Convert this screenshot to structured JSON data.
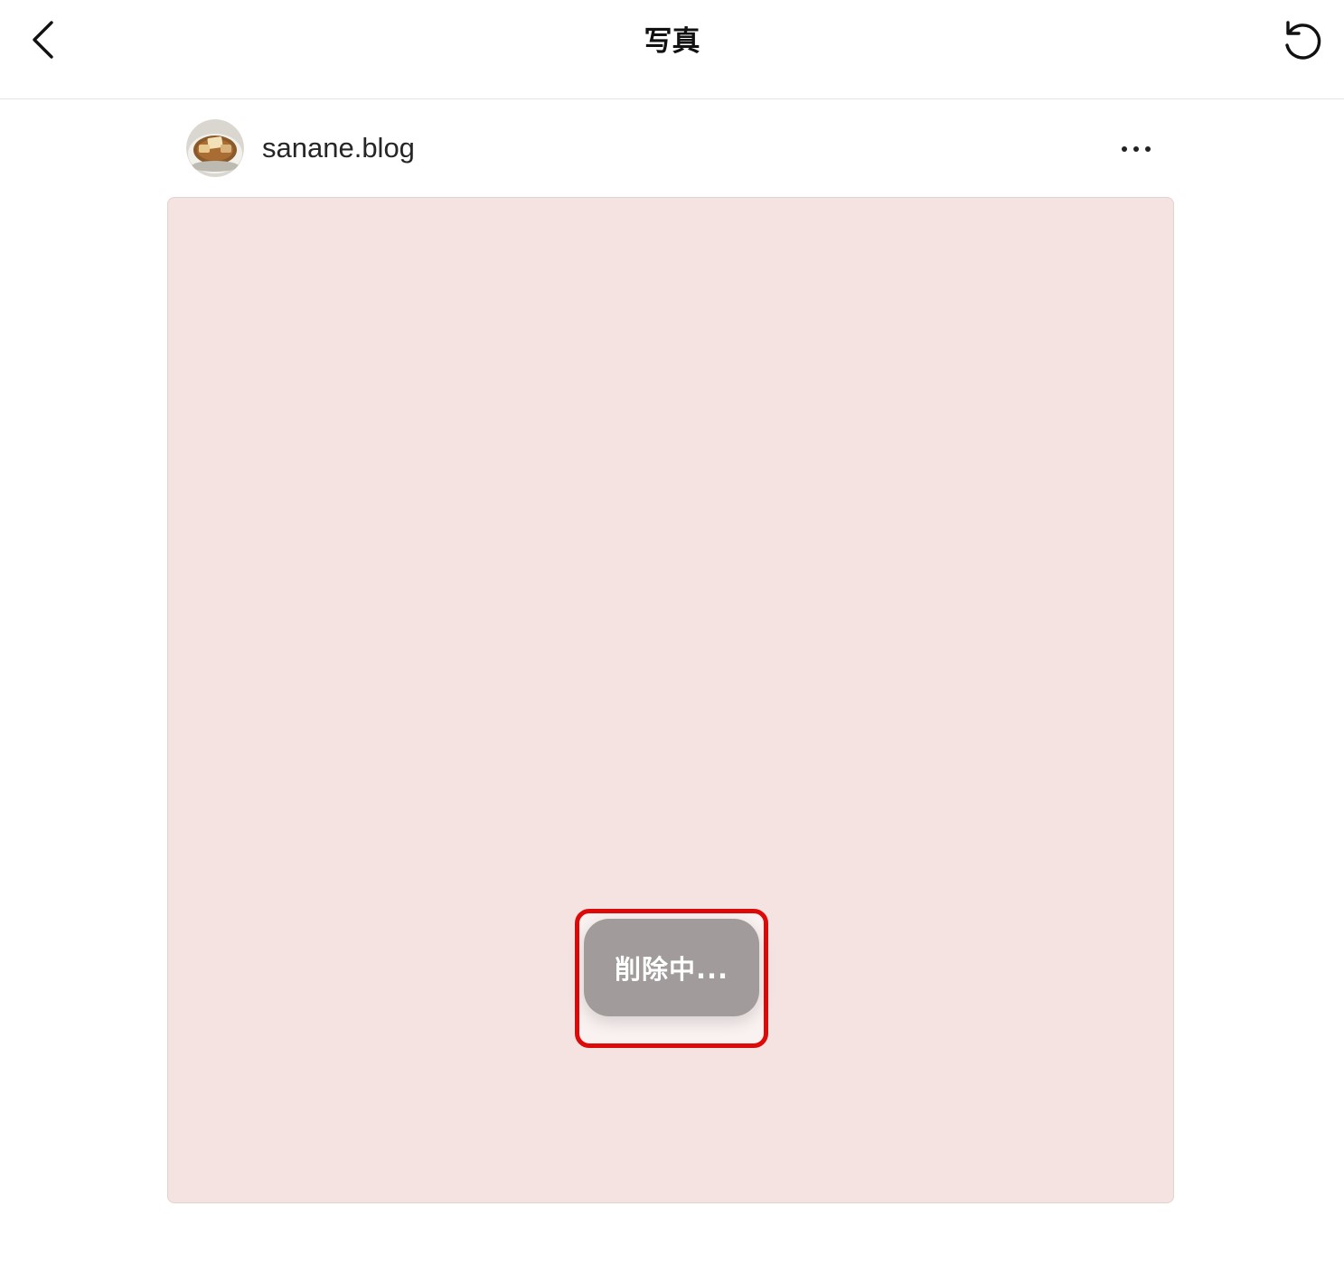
{
  "header": {
    "title": "写真",
    "back_icon": "chevron-left-icon",
    "refresh_icon": "refresh-icon"
  },
  "post": {
    "username": "sanane.blog",
    "avatar_icon": "food-bowl-avatar",
    "more_icon": "more-horizontal-icon",
    "photo_background": "#f4e3e1"
  },
  "toast": {
    "label": "削除中...",
    "highlight_color": "#dd0a0a"
  }
}
